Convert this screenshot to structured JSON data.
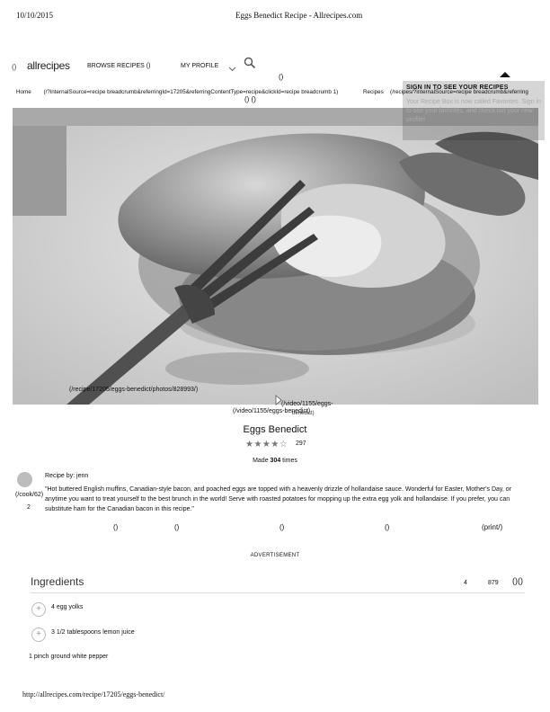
{
  "print_header": {
    "date": "10/10/2015",
    "title": "Eggs Benedict Recipe - Allrecipes.com"
  },
  "site_nav": {
    "logo_mark": "()",
    "logo": "allrecipes",
    "browse": "BROWSE RECIPES ()",
    "profile": "MY PROFILE",
    "center_zero": "()"
  },
  "breadcrumb": {
    "home": "Home",
    "long1": "(/?internalSource=recipe breadcrumb&referringId=17205&referringContentType=recipe&clickId=recipe breadcrumb 1)",
    "recipes": "Recipes",
    "long2": "(/recipes/?internalSource=recipe breadcrumb&referring",
    "zeros": "()   ()"
  },
  "popup": {
    "title": "SIGN IN TO SEE YOUR RECIPES",
    "body": "Your Recipe Box is now called Favorites. Sign in to see your favorites, and check out your new profile!"
  },
  "hero": {
    "photo_link": "(/recipe/17205/eggs-benedict/photos/828993/)",
    "video_link1": "(/video/1155/eggs-",
    "video_link2": "(/video/1155/eggs-benedict)",
    "video_link3": "benedict)"
  },
  "recipe": {
    "title": "Eggs Benedict",
    "stars": "★★★★☆",
    "rating_count": "297",
    "made_prefix": "Made ",
    "made_count": "304",
    "made_suffix": " times",
    "cook_link": "(/cook/62)",
    "cook_count": "2",
    "recipe_by": "Recipe by: jenn",
    "description": "\"Hot buttered English muffins, Canadian-style bacon, and poached eggs are topped with a heavenly drizzle of hollandaise sauce. Wonderful for Easter, Mother's Day, or anytime you want to treat yourself to the best brunch in the world! Serve with roasted potatoes for mopping up the extra egg yolk and hollandaise. If you prefer, you can substitute ham for the Canadian bacon in this recipe.\""
  },
  "actions": [
    "()",
    "()",
    "()",
    "()",
    "(print/)"
  ],
  "advertisement": "ADVERTISEMENT",
  "ingredients": {
    "title": "Ingredients",
    "count1": "4",
    "count2": "879",
    "zeros": "()()",
    "items": [
      "4 egg yolks",
      "3 1/2 tablespoons lemon juice",
      "1 pinch ground white pepper"
    ]
  },
  "footer": {
    "url": "http://allrecipes.com/recipe/17205/eggs-benedict/"
  }
}
